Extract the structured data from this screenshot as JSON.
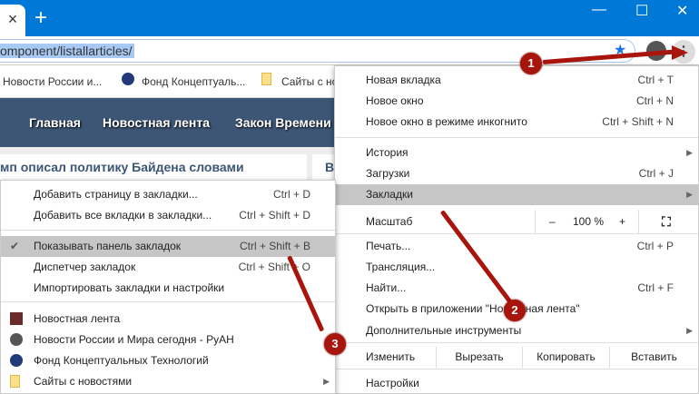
{
  "tab": {
    "close": "×",
    "new": "+"
  },
  "window": {
    "min": "—",
    "max": "☐",
    "close": "✕"
  },
  "address": {
    "url": "omponent/listallarticles/"
  },
  "bookmarks_bar": [
    "Новости России и...",
    "Фонд Концептуаль...",
    "Сайты с но"
  ],
  "nav": [
    "Главная",
    "Новостная лента",
    "Закон Времени"
  ],
  "article": {
    "headline": "мп описал политику Байдена словами",
    "side": "В"
  },
  "main_menu": {
    "items": [
      {
        "label": "Новая вкладка",
        "shortcut": "Ctrl + T"
      },
      {
        "label": "Новое окно",
        "shortcut": "Ctrl + N"
      },
      {
        "label": "Новое окно в режиме инкогнито",
        "shortcut": "Ctrl + Shift + N"
      },
      {
        "label": "История",
        "shortcut": ""
      },
      {
        "label": "Загрузки",
        "shortcut": "Ctrl + J"
      },
      {
        "label": "Закладки",
        "shortcut": ""
      },
      {
        "label": "Печать...",
        "shortcut": "Ctrl + P"
      },
      {
        "label": "Трансляция...",
        "shortcut": ""
      },
      {
        "label": "Найти...",
        "shortcut": "Ctrl + F"
      },
      {
        "label": "Открыть в приложении \"Новостная лента\"",
        "shortcut": ""
      },
      {
        "label": "Дополнительные инструменты",
        "shortcut": ""
      },
      {
        "label": "Настройки",
        "shortcut": ""
      }
    ],
    "zoom": {
      "label": "Масштаб",
      "minus": "–",
      "value": "100 %",
      "plus": "+"
    },
    "edit": {
      "label": "Изменить",
      "cut": "Вырезать",
      "copy": "Копировать",
      "paste": "Вставить"
    }
  },
  "bookmarks_menu": {
    "items": [
      {
        "label": "Добавить страницу в закладки...",
        "shortcut": "Ctrl + D"
      },
      {
        "label": "Добавить все вкладки в закладки...",
        "shortcut": "Ctrl + Shift + D"
      },
      {
        "label": "Показывать панель закладок",
        "shortcut": "Ctrl + Shift + B"
      },
      {
        "label": "Диспетчер закладок",
        "shortcut": "Ctrl + Shift + O"
      },
      {
        "label": "Импортировать закладки и настройки",
        "shortcut": ""
      },
      {
        "label": "Новостная лента",
        "shortcut": ""
      },
      {
        "label": "Новости России и Мира сегодня - РуАН",
        "shortcut": ""
      },
      {
        "label": "Фонд Концептуальных Технологий",
        "shortcut": ""
      },
      {
        "label": "Сайты с новостями",
        "shortcut": ""
      }
    ],
    "check": "✔"
  },
  "badges": [
    "1",
    "2",
    "3"
  ]
}
